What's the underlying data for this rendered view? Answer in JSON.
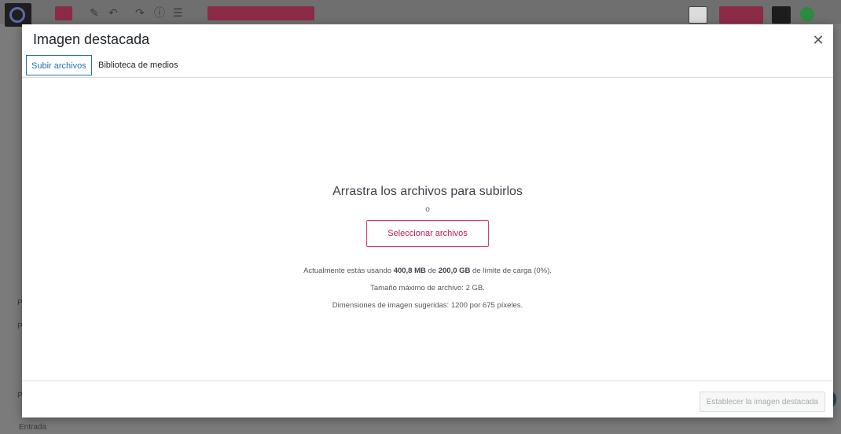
{
  "background": {
    "sidebar_label": "Entrada",
    "side_letters": [
      "P",
      "P",
      "P"
    ]
  },
  "modal": {
    "title": "Imagen destacada",
    "close_icon": "close-icon",
    "tabs": [
      {
        "label": "Subir archivos",
        "active": true
      },
      {
        "label": "Biblioteca de medios",
        "active": false
      }
    ],
    "upload": {
      "drop_title": "Arrastra los archivos para subirlos",
      "or_text": "o",
      "select_button": "Seleccionar archivos",
      "usage_prefix": "Actualmente estás usando ",
      "usage_used": "400,8 MB",
      "usage_mid": " de ",
      "usage_limit": "200,0 GB",
      "usage_suffix": " de límite de carga (0%).",
      "max_size": "Tamaño máximo de archivo: 2 GB.",
      "suggested_dimensions": "Dimensiones de imagen sugeridas: 1200 por 675 píxeles."
    },
    "footer": {
      "set_featured_button": "Establecer la imagen destacada"
    }
  },
  "colors": {
    "accent": "#2271b1",
    "select_button": "#d63d68",
    "overlay": "#7b7b7b"
  }
}
